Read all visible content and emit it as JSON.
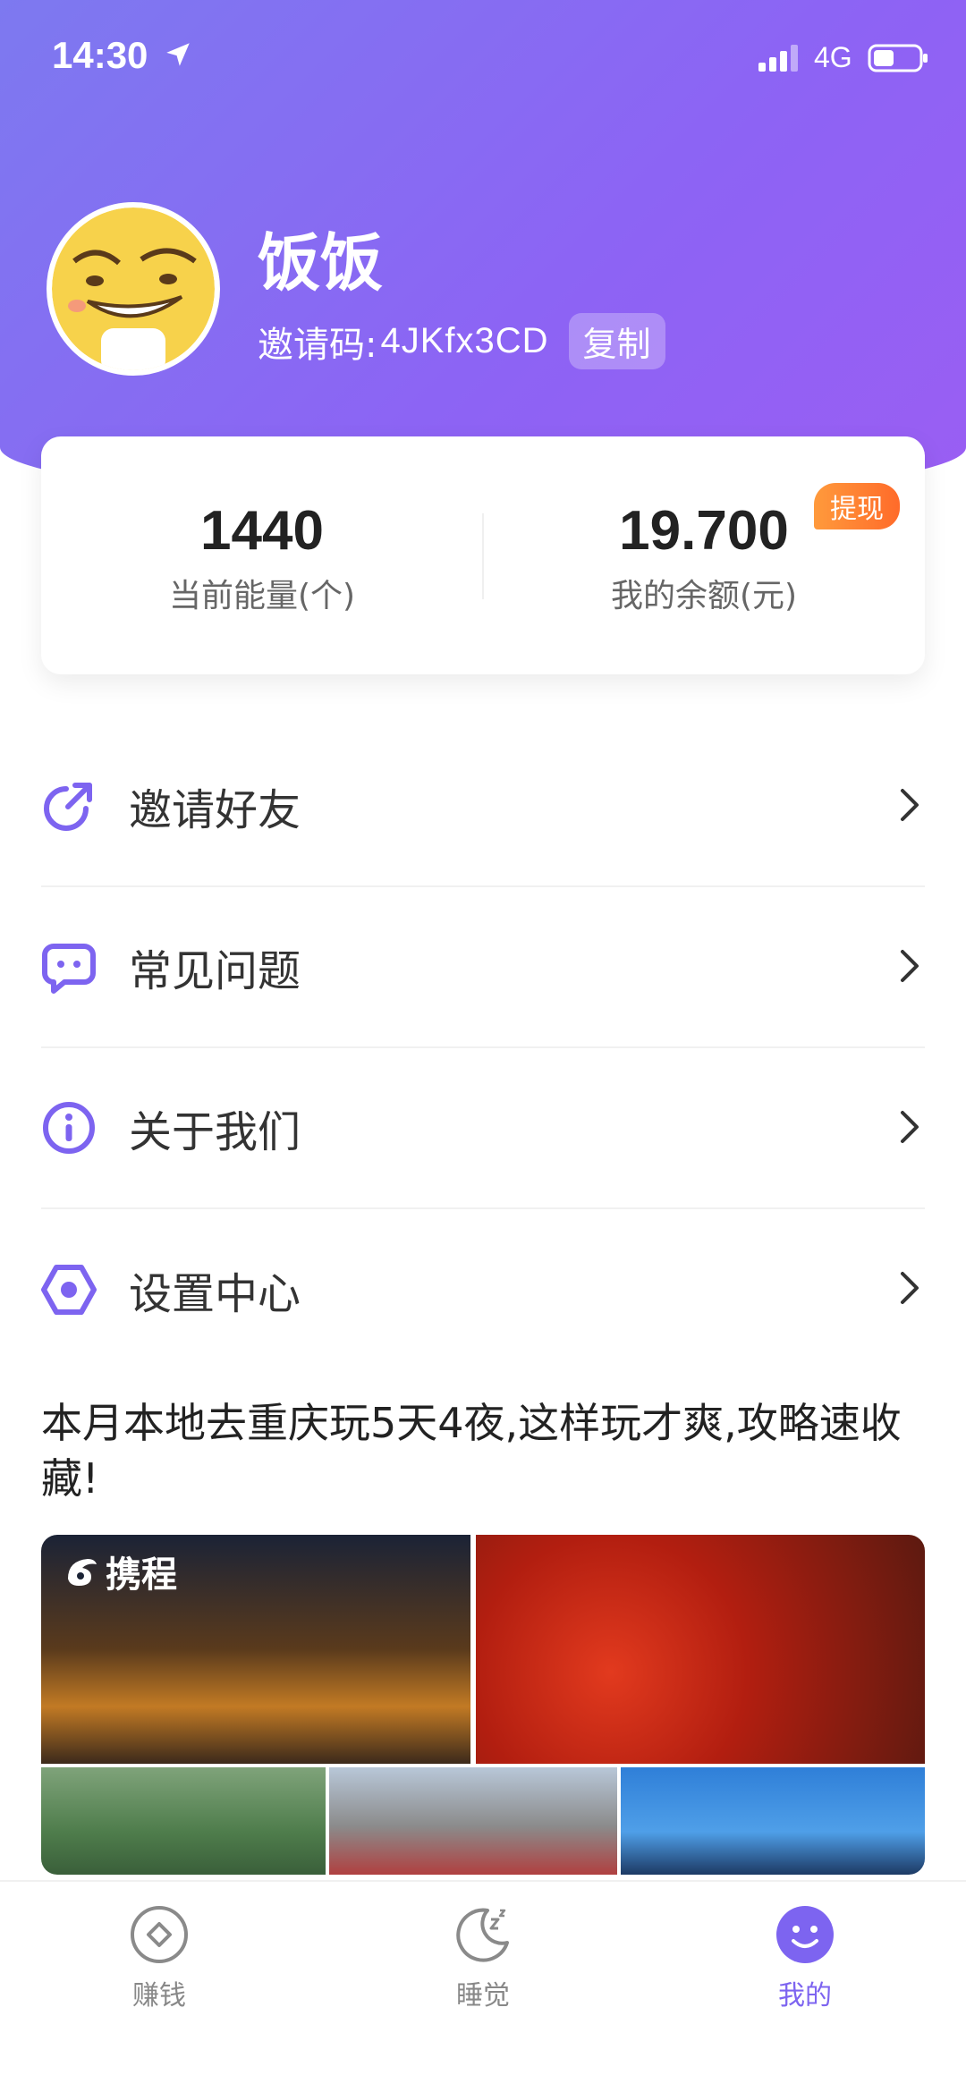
{
  "status_bar": {
    "time": "14:30",
    "network": "4G"
  },
  "profile": {
    "name": "饭饭",
    "invite_label": "邀请码:",
    "invite_code": "4JKfx3CD",
    "copy_label": "复制"
  },
  "stats": {
    "energy_value": "1440",
    "energy_label": "当前能量(个)",
    "balance_value": "19.700",
    "balance_label": "我的余额(元)",
    "withdraw_label": "提现"
  },
  "menu": {
    "items": [
      {
        "label": "邀请好友",
        "icon": "share-arrow-icon"
      },
      {
        "label": "常见问题",
        "icon": "chat-bubble-icon"
      },
      {
        "label": "关于我们",
        "icon": "info-icon"
      },
      {
        "label": "设置中心",
        "icon": "hexagon-settings-icon"
      }
    ]
  },
  "article": {
    "title": "本月本地去重庆玩5天4夜,这样玩才爽,攻略速收藏!",
    "brand": "携程"
  },
  "tabbar": {
    "tabs": [
      {
        "label": "赚钱",
        "icon": "target-icon"
      },
      {
        "label": "睡觉",
        "icon": "moon-icon"
      },
      {
        "label": "我的",
        "icon": "smile-icon"
      }
    ]
  },
  "colors": {
    "accent": "#7d64f0",
    "header_start": "#7d79f0",
    "header_end": "#9a5ef3",
    "badge": "#ff7a2f"
  }
}
